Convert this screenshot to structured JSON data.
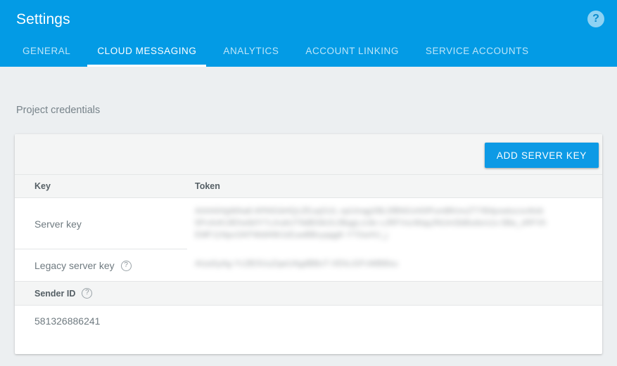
{
  "header": {
    "title": "Settings",
    "help_icon": "help-circle-icon",
    "accent_color": "#039be5",
    "tabs": [
      {
        "label": "GENERAL",
        "active": false
      },
      {
        "label": "CLOUD MESSAGING",
        "active": true
      },
      {
        "label": "ANALYTICS",
        "active": false
      },
      {
        "label": "ACCOUNT LINKING",
        "active": false
      },
      {
        "label": "SERVICE ACCOUNTS",
        "active": false
      }
    ]
  },
  "page": {
    "background_color": "#eceff1",
    "section_label": "Project credentials"
  },
  "card": {
    "toolbar": {
      "add_server_key_label": "ADD SERVER KEY",
      "button_color": "#0d9ae5"
    },
    "table": {
      "columns": [
        "Key",
        "Token"
      ],
      "rows": [
        {
          "key": "Server key",
          "has_help_icon": false,
          "token": "AAAAiHgWAa8:APA91bHQcZEuqGUL-xpUmqgXBL5fBNGvh0IPumBKmvZTYB4pxwtucxx4txb5Pc4nKUlEheib0Y7cJrubUT9dBS9iJUJBqgLcUkr-cJRFVscWqqJNUmSbBxdsrs1s-5Ba_sRFVhEMF11NpcGKFWdAlWJzEuwBBcyqqgK-Y7GwXU_j",
          "token_redacted": true
        },
        {
          "key": "Legacy server key",
          "has_help_icon": true,
          "token": "AIzaSyAg-Yc2lE0UuZqwUAgdBBoT-VEhLiGFvWB8lxu",
          "token_redacted": true
        }
      ]
    },
    "sender_id": {
      "label": "Sender ID",
      "has_help_icon": true,
      "value": "581326886241"
    }
  },
  "icons": {
    "help_glyph": "?"
  }
}
